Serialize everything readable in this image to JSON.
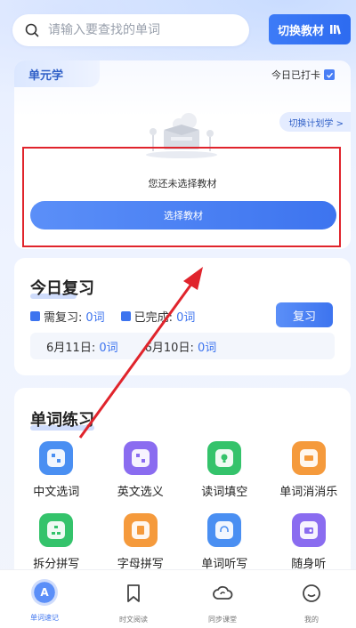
{
  "search": {
    "placeholder": "请输入要查找的单词"
  },
  "header": {
    "switch_book_label": "切换教材"
  },
  "unit": {
    "tab_label": "单元学",
    "checkin_label": "今日已打卡",
    "switch_plan_label": "切换计划学 >",
    "empty_text": "您还未选择教材",
    "select_button_label": "选择教材"
  },
  "review": {
    "title": "今日复习",
    "need_label": "需复习:",
    "need_value": "0词",
    "done_label": "已完成:",
    "done_value": "0词",
    "button_label": "复习",
    "dates": [
      {
        "label": "6月11日:",
        "value": "0词"
      },
      {
        "label": "6月10日:",
        "value": "0词"
      }
    ]
  },
  "practice": {
    "title": "单词练习",
    "items": [
      {
        "label": "中文选词",
        "color": "#4a8ff2",
        "icon": "grid-icon"
      },
      {
        "label": "英文选义",
        "color": "#8a6cf0",
        "icon": "grid-icon"
      },
      {
        "label": "读词填空",
        "color": "#34c36b",
        "icon": "bulb-icon"
      },
      {
        "label": "单词消消乐",
        "color": "#f59a3c",
        "icon": "puzzle-icon"
      },
      {
        "label": "拆分拼写",
        "color": "#34c36b",
        "icon": "tree-icon"
      },
      {
        "label": "字母拼写",
        "color": "#f59a3c",
        "icon": "letters-icon"
      },
      {
        "label": "单词听写",
        "color": "#4a8ff2",
        "icon": "headphone-icon"
      },
      {
        "label": "随身听",
        "color": "#8a6cf0",
        "icon": "radio-icon"
      }
    ]
  },
  "nav": {
    "items": [
      {
        "label": "单词速记",
        "icon": "word-icon"
      },
      {
        "label": "时文阅读",
        "icon": "bookmark-icon"
      },
      {
        "label": "同步课堂",
        "icon": "cloud-icon"
      },
      {
        "label": "我的",
        "icon": "smile-icon"
      }
    ],
    "active_badge": "A"
  },
  "colors": {
    "accent": "#3d74ef",
    "annotation": "#e0242c"
  }
}
